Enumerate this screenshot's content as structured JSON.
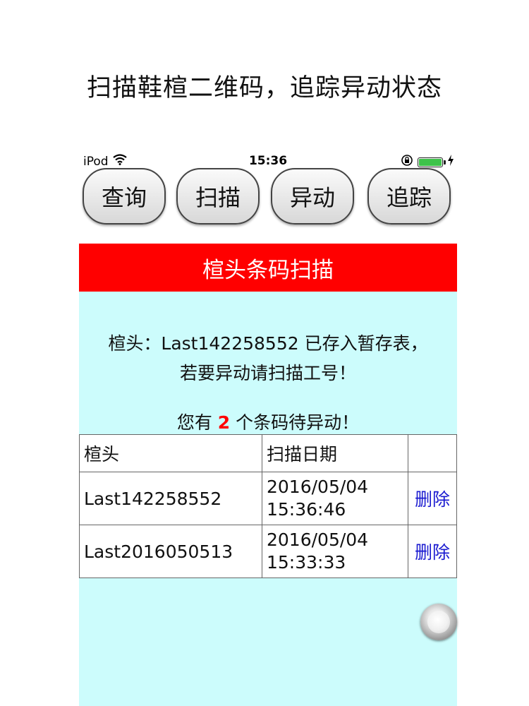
{
  "caption": "扫描鞋楦二维码，追踪异动状态",
  "status_bar": {
    "device": "iPod",
    "time": "15:36"
  },
  "nav": {
    "query": "查询",
    "scan": "扫描",
    "move": "异动",
    "track": "追踪"
  },
  "panel": {
    "title": "楦头条码扫描",
    "message_line1": "楦头：Last142258552 已存入暂存表，",
    "message_line2": "若要异动请扫描工号！",
    "pending_prefix": "您有",
    "pending_count": "2",
    "pending_suffix": "个条码待异动！"
  },
  "table": {
    "headers": [
      "楦头",
      "扫描日期",
      ""
    ],
    "rows": [
      {
        "last": "Last142258552",
        "date": "2016/05/04",
        "time": "15:36:46",
        "action": "删除"
      },
      {
        "last": "Last2016050513",
        "date": "2016/05/04",
        "time": "15:33:33",
        "action": "删除"
      }
    ]
  },
  "colors": {
    "header_bg": "#ff0000",
    "panel_bg": "#ccfcfc",
    "link": "#1a1ad0",
    "battery": "#3ec34a"
  }
}
